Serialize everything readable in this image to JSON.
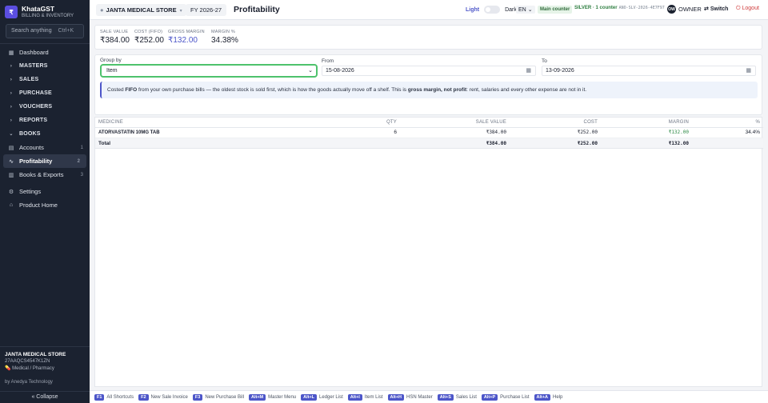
{
  "brand": {
    "logo": "₹",
    "name": "KhataGST",
    "subtitle": "BILLING & INVENTORY"
  },
  "search": {
    "placeholder": "Search anything",
    "shortcut": "Ctrl+K"
  },
  "sidebar": {
    "items": [
      {
        "icon": "dashboard-icon",
        "glyph": "▦",
        "label": "Dashboard"
      },
      {
        "icon": "chevron-right-icon",
        "glyph": "›",
        "label": "MASTERS"
      },
      {
        "icon": "chevron-right-icon",
        "glyph": "›",
        "label": "SALES"
      },
      {
        "icon": "chevron-right-icon",
        "glyph": "›",
        "label": "PURCHASE"
      },
      {
        "icon": "chevron-right-icon",
        "glyph": "›",
        "label": "VOUCHERS"
      },
      {
        "icon": "chevron-right-icon",
        "glyph": "›",
        "label": "REPORTS"
      },
      {
        "icon": "chevron-down-icon",
        "glyph": "⌄",
        "label": "BOOKS"
      },
      {
        "icon": "ledger-icon",
        "glyph": "▤",
        "label": "Accounts",
        "num": "1"
      },
      {
        "icon": "trend-icon",
        "glyph": "∿",
        "label": "Profitability",
        "num": "2"
      },
      {
        "icon": "book-icon",
        "glyph": "▥",
        "label": "Books & Exports",
        "num": "3"
      },
      {
        "icon": "gear-icon",
        "glyph": "⚙",
        "label": "Settings"
      },
      {
        "icon": "home-icon",
        "glyph": "⌂",
        "label": "Product Home"
      }
    ],
    "footer": {
      "store": "JANTA MEDICAL STORE",
      "gstin": "27AAQCS4547K1ZN",
      "type": "Medical / Pharmacy",
      "by": "by Anedya Technology",
      "collapse": "« Collapse"
    }
  },
  "topbar": {
    "store": "JANTA MEDICAL STORE",
    "fy": "FY 2026-27",
    "title": "Profitability",
    "theme_light": "Light",
    "theme_dark": "Dark",
    "lang": "EN",
    "counter": "Main counter",
    "license_tier": "SILVER · 1 counter",
    "license_key": "ANO-SLV-2026-4E7F97",
    "owner_initials": "OW",
    "owner": "OWNER",
    "switch": "Switch",
    "logout": "Logout"
  },
  "summary": {
    "sale_value_label": "SALE VALUE",
    "sale_value": "₹384.00",
    "cost_label": "COST (FIFO)",
    "cost": "₹252.00",
    "gross_margin_label": "GROSS MARGIN",
    "gross_margin": "₹132.00",
    "margin_pct_label": "MARGIN %",
    "margin_pct": "34.38%"
  },
  "filters": {
    "group_by_label": "Group by",
    "group_by_value": "Item",
    "from_label": "From",
    "from_value": "15-08-2026",
    "to_label": "To",
    "to_value": "13-09-2026"
  },
  "note": {
    "part1": "Costed ",
    "fifo": "FIFO",
    "part2": " from your own purchase bills — the oldest stock is sold first, which is how the goods actually move off a shelf. This is ",
    "gross": "gross margin, not profit",
    "part3": ": rent, salaries and every other expense are not in it."
  },
  "table": {
    "headers": {
      "medicine": "MEDICINE",
      "qty": "QTY",
      "sale_value": "SALE VALUE",
      "cost": "COST",
      "margin": "MARGIN",
      "pct": "%"
    },
    "rows": [
      {
        "medicine": "ATORVASTATIN 10MG TAB",
        "qty": "6",
        "sale_value": "₹384.00",
        "cost": "₹252.00",
        "margin": "₹132.00",
        "pct": "34.4%"
      }
    ],
    "total": {
      "label": "Total",
      "sale_value": "₹384.00",
      "cost": "₹252.00",
      "margin": "₹132.00"
    }
  },
  "shortcuts": [
    {
      "key": "F1",
      "label": "All Shortcuts"
    },
    {
      "key": "F2",
      "label": "New Sale Invoice"
    },
    {
      "key": "F3",
      "label": "New Purchase Bill"
    },
    {
      "key": "Alt+M",
      "label": "Master Menu"
    },
    {
      "key": "Alt+L",
      "label": "Ledger List"
    },
    {
      "key": "Alt+I",
      "label": "Item List"
    },
    {
      "key": "Alt+H",
      "label": "HSN Master"
    },
    {
      "key": "Alt+S",
      "label": "Sales List"
    },
    {
      "key": "Alt+P",
      "label": "Purchase List"
    },
    {
      "key": "Alt+A",
      "label": "Help"
    }
  ],
  "colors": {
    "accent": "#4d56c9",
    "sidebar_bg": "#1b2230",
    "positive": "#2c8a45",
    "focus": "#4ec26c",
    "danger": "#cf3b3b"
  }
}
